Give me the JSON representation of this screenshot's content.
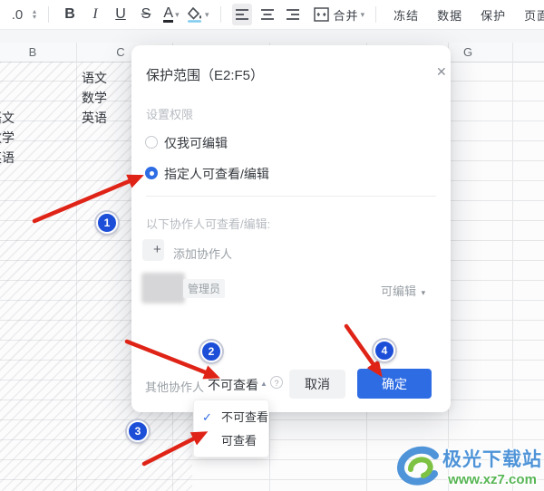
{
  "toolbar": {
    "number_format": ".0",
    "bold": "B",
    "italic": "I",
    "underline": "U",
    "strikethrough": "S",
    "font_color": "A",
    "merge_label": "合并",
    "freeze_label": "冻结",
    "data_label": "数据",
    "protect_label": "保护",
    "page_label": "页面"
  },
  "sheet": {
    "column_headers": [
      "B",
      "C",
      "G"
    ],
    "col_c_cells": [
      "语文",
      "数学",
      "英语"
    ],
    "col_a_cells": [
      "语文",
      "数学",
      "英语"
    ]
  },
  "dialog": {
    "title": "保护范围（E2:F5）",
    "permission_section": "设置权限",
    "radios": [
      {
        "label": "仅我可编辑",
        "selected": false
      },
      {
        "label": "指定人可查看/编辑",
        "selected": true
      }
    ],
    "collaborators_section": "以下协作人可查看/编辑:",
    "add_collaborator": "添加协作人",
    "member": {
      "role_badge": "管理员",
      "permission": "可编辑"
    },
    "footer": {
      "others_label": "其他协作人",
      "others_value": "不可查看",
      "cancel": "取消",
      "confirm": "确定"
    }
  },
  "dropdown_menu": {
    "items": [
      {
        "label": "不可查看",
        "checked": true
      },
      {
        "label": "可查看",
        "checked": false
      }
    ]
  },
  "icons": {
    "close": "✕",
    "plus": "+",
    "help": "?",
    "check": "✓",
    "caret_down": "▾",
    "caret_up": "▲",
    "spinner_up": "▴",
    "spinner_down": "▾"
  },
  "badges": [
    "1",
    "2",
    "3",
    "4"
  ],
  "watermark": {
    "site_name": "极光下载站",
    "site_url": "www.xz7.com"
  },
  "colors": {
    "accent_blue": "#2e6ce4",
    "arrow_red": "#df2417",
    "badge_blue": "#1c4ed8",
    "watermark_blue": "#4f94d8",
    "watermark_green": "#57b554",
    "gridline": "#e5e6e8"
  }
}
